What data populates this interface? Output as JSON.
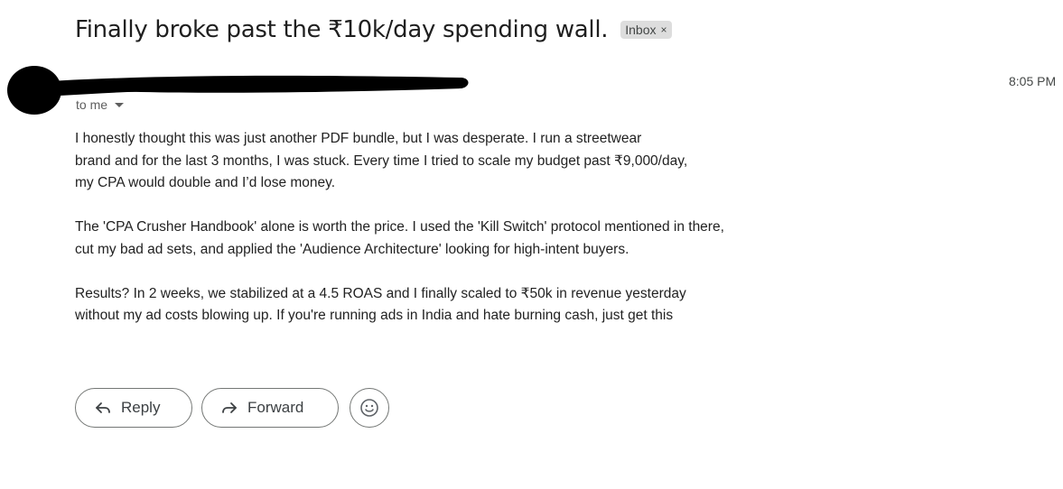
{
  "email": {
    "subject": "Finally broke past the ₹10k/day spending wall.",
    "label": "Inbox",
    "label_remove_glyph": "×",
    "time": "8:05 PM",
    "recipient": "to me",
    "paragraphs": [
      [
        "I honestly thought this was just another PDF bundle, but I was desperate. I run a streetwear",
        "brand and for the last 3 months, I was stuck. Every time I tried to scale my budget past ₹9,000/day,",
        "my CPA would double and I’d lose money."
      ],
      [
        "The 'CPA Crusher Handbook' alone is worth the price. I used the 'Kill Switch' protocol mentioned in there,",
        "cut my bad ad sets, and applied the 'Audience Architecture' looking for high-intent buyers."
      ],
      [
        "Results? In 2 weeks, we stabilized at a 4.5 ROAS and I finally scaled to ₹50k in revenue yesterday",
        "without my ad costs blowing up. If you're running ads in India and hate burning cash, just get this"
      ]
    ]
  },
  "actions": {
    "reply_label": "Reply",
    "forward_label": "Forward"
  },
  "icons": {
    "reply": "reply-arrow-icon",
    "forward": "forward-arrow-icon",
    "emoji": "smiley-icon",
    "recipient_expand": "caret-down-icon"
  },
  "colors": {
    "chip_bg": "#dddddd",
    "border": "#747775",
    "text": "#1f1f1f"
  }
}
